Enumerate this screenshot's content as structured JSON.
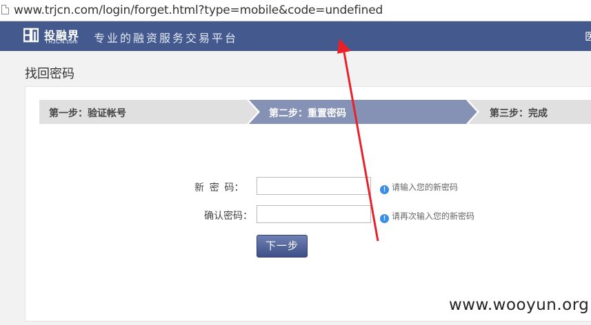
{
  "browser": {
    "url": "www.trjcn.com/login/forget.html?type=mobile&code=undefined"
  },
  "header": {
    "logo_cn": "投融界",
    "logo_en": "TRJCN.com",
    "slogan": "专业的融资服务交易平台",
    "right_text": "医",
    "bg_color": "#445a8e"
  },
  "page": {
    "title": "找回密码"
  },
  "steps": [
    {
      "label": "第一步：验证帐号",
      "state": "done"
    },
    {
      "label": "第二步：重置密码",
      "state": "active"
    },
    {
      "label": "第三步：完成",
      "state": "pending"
    }
  ],
  "form": {
    "new_password": {
      "label": "新  密  码：",
      "value": "",
      "hint": "请输入您的新密码"
    },
    "confirm_password": {
      "label": "确认密码：",
      "value": "",
      "hint": "请再次输入您的新密码"
    },
    "next_button": "下一步"
  },
  "annotation": {
    "watermark": "www.wooyun.org",
    "arrow_color": "#e8202a"
  },
  "icons": {
    "hint": "info-icon",
    "page": "page-icon",
    "logo": "logo-mark-icon"
  }
}
